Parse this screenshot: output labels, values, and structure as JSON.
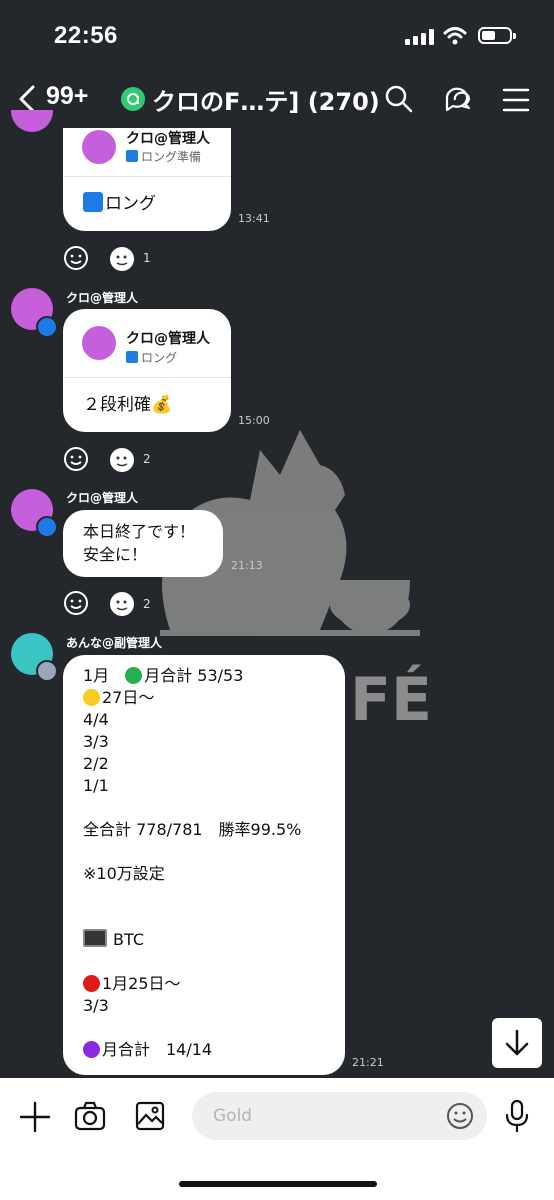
{
  "status": {
    "time": "22:56"
  },
  "header": {
    "unread": "99+",
    "title": "クロのF…テ] (270)"
  },
  "messages": [
    {
      "quote_name": "クロ@管理人",
      "quote_text": "ロング準備",
      "body": "ロング",
      "time": "13:41",
      "reaction_count": "1"
    },
    {
      "sender": "クロ@管理人",
      "quote_name": "クロ@管理人",
      "quote_text": "ロング",
      "body": "２段利確💰",
      "time": "15:00",
      "reaction_count": "2"
    },
    {
      "sender": "クロ@管理人",
      "line1": "本日終了です！",
      "line2": "安全に！",
      "time": "21:13",
      "reaction_count": "2"
    },
    {
      "sender": "あんな@副管理人",
      "time": "21:21"
    }
  ],
  "long_message": {
    "l1a": "1月　",
    "l1b": "月合計 53/53",
    "l2": "27日〜",
    "l3": "4/4",
    "l4": "3/3",
    "l5": "2/2",
    "l6": "1/1",
    "l7": "全合計 778/781　勝率99.5%",
    "l8": "※10万設定",
    "l9": "BTC",
    "l10": "1月25日〜",
    "l11": "3/3",
    "l12": "月合計　14/14"
  },
  "composer": {
    "placeholder": "Gold"
  },
  "colors": {
    "background": "#24272c",
    "bubble": "#ffffff",
    "accent_green": "#2ecc71",
    "blue_square": "#1e7be6"
  },
  "icons": [
    "back-icon",
    "group-icon",
    "search-icon",
    "chat-icon",
    "menu-icon",
    "smile-icon",
    "thumbs-up-icon",
    "plus-icon",
    "camera-icon",
    "image-icon",
    "emoji-icon",
    "mic-icon",
    "arrow-down-icon"
  ]
}
